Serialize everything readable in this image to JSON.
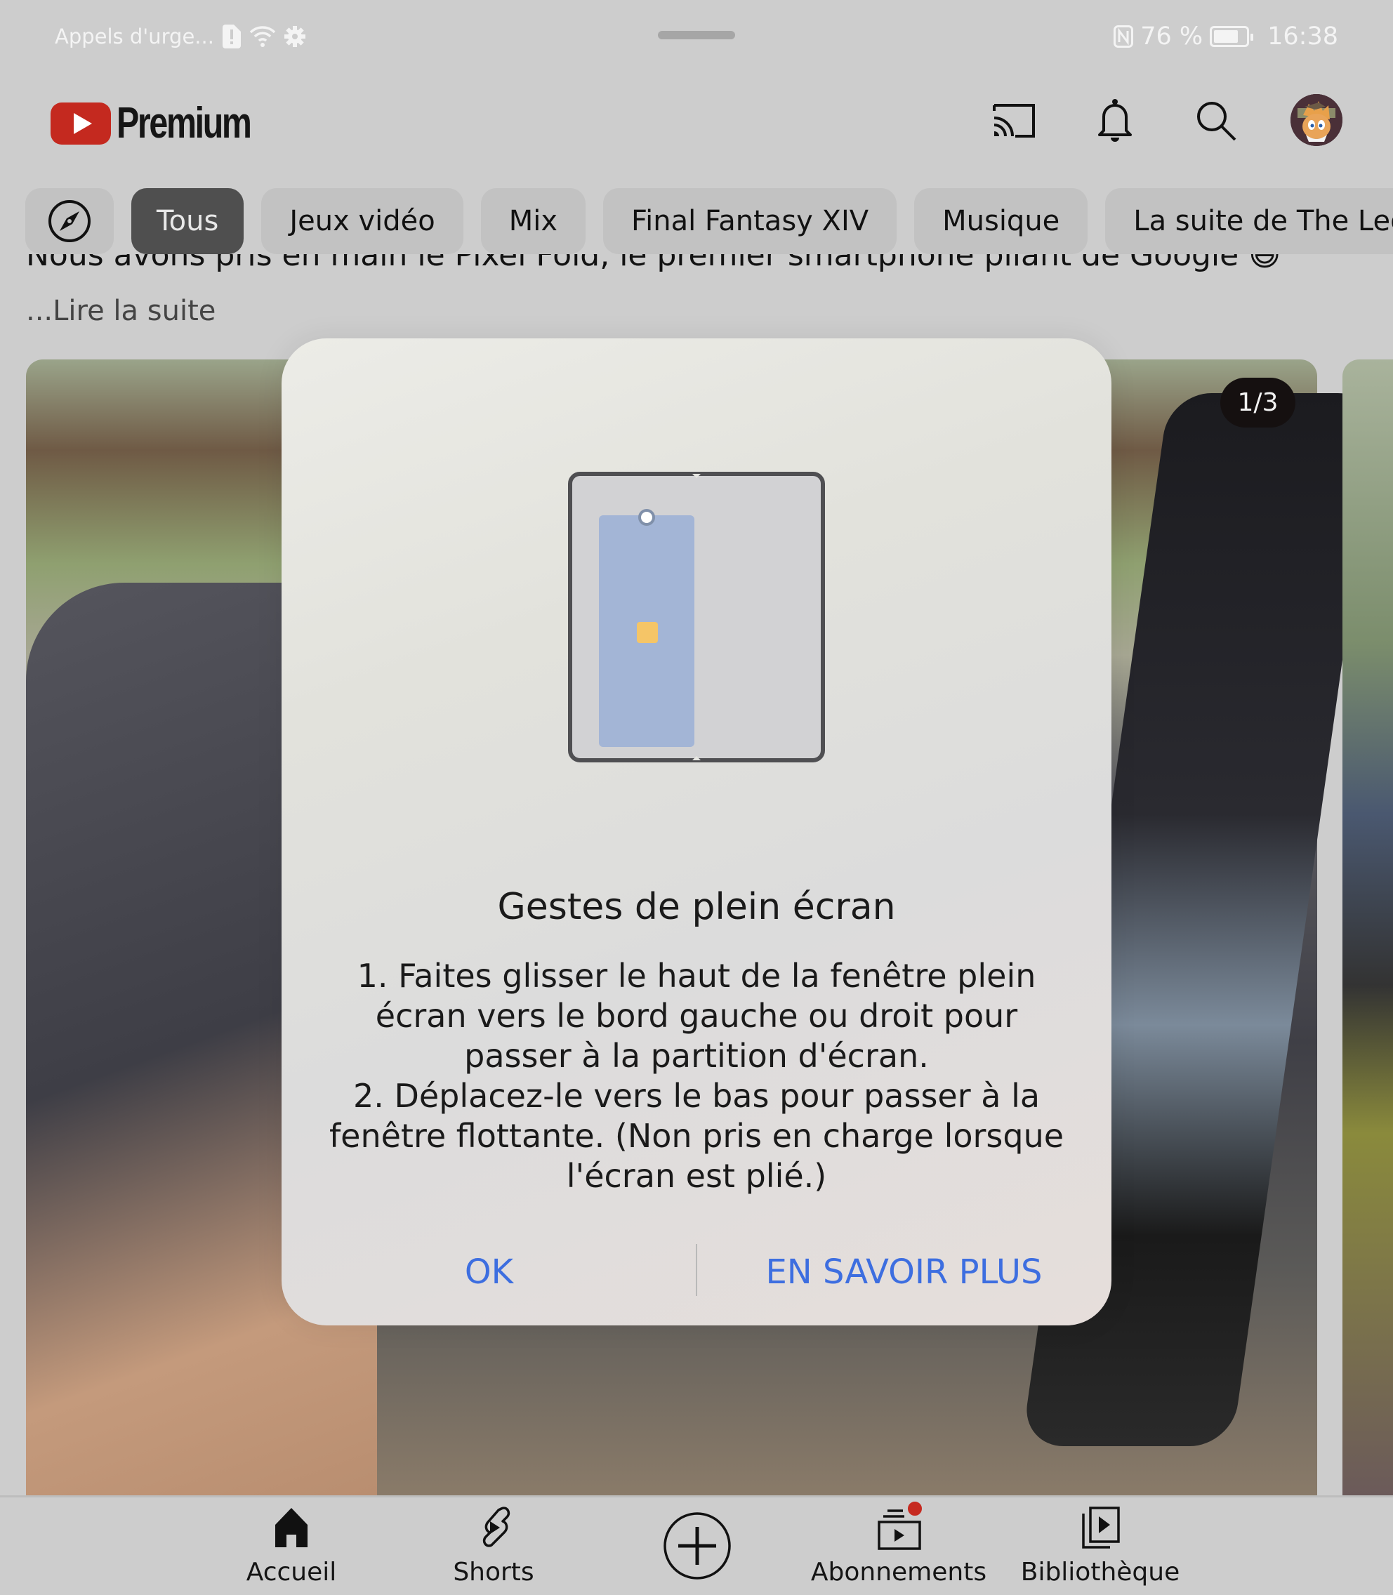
{
  "status_bar": {
    "left_text": "Appels d'urge...",
    "battery_percent_text": "76 %",
    "battery_level": 0.76,
    "time": "16:38",
    "icons": [
      "sim-alert-icon",
      "wifi-icon",
      "settings-icon",
      "nfc-icon",
      "battery-icon"
    ]
  },
  "header": {
    "logo_text": "Premium",
    "icons": [
      "cast-icon",
      "bell-icon",
      "search-icon",
      "avatar"
    ]
  },
  "chips": [
    {
      "label": "",
      "icon": "compass-icon",
      "active": false
    },
    {
      "label": "Tous",
      "active": true
    },
    {
      "label": "Jeux vidéo",
      "active": false
    },
    {
      "label": "Mix",
      "active": false
    },
    {
      "label": "Final Fantasy XIV",
      "active": false
    },
    {
      "label": "Musique",
      "active": false
    },
    {
      "label": "La suite de The Leg",
      "active": false
    }
  ],
  "post": {
    "text": "Nous avons pris en main le Pixel Fold, le premier smartphone pliant de Google 😄",
    "read_more": "...Lire la suite",
    "image_counter": "1/3"
  },
  "dialog": {
    "title": "Gestes de plein écran",
    "body": "1. Faites glisser le haut de la fenêtre plein\nécran vers le bord gauche ou droit pour\npasser à la partition d'écran.\n2. Déplacez-le vers le bas pour passer à la\nfenêtre flottante. (Non pris en charge lorsque\nl'écran est plié.)",
    "ok_label": "OK",
    "more_label": "EN SAVOIR PLUS",
    "accent_color": "#3d6ee0"
  },
  "bottom_nav": {
    "items": [
      {
        "label": "Accueil",
        "icon": "home-icon"
      },
      {
        "label": "Shorts",
        "icon": "shorts-icon"
      },
      {
        "label": "",
        "icon": "create-icon"
      },
      {
        "label": "Abonnements",
        "icon": "subscriptions-icon",
        "badge": true
      },
      {
        "label": "Bibliothèque",
        "icon": "library-icon"
      }
    ]
  }
}
